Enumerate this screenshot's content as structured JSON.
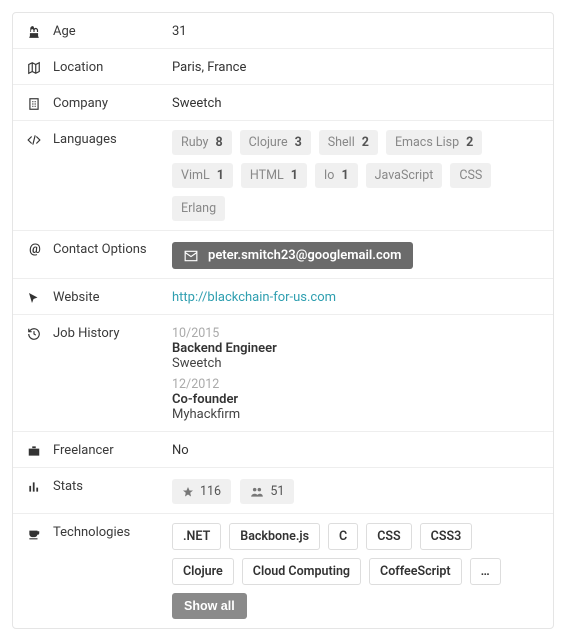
{
  "fields": {
    "age": "Age",
    "location": "Location",
    "company": "Company",
    "languages": "Languages",
    "contact": "Contact Options",
    "website": "Website",
    "job_history": "Job History",
    "freelancer": "Freelancer",
    "stats": "Stats",
    "technologies": "Technologies"
  },
  "values": {
    "age": "31",
    "location": "Paris, France",
    "company": "Sweetch",
    "freelancer": "No",
    "website": "http://blackchain-for-us.com"
  },
  "languages": [
    {
      "name": "Ruby",
      "count": "8"
    },
    {
      "name": "Clojure",
      "count": "3"
    },
    {
      "name": "Shell",
      "count": "2"
    },
    {
      "name": "Emacs Lisp",
      "count": "2"
    },
    {
      "name": "VimL",
      "count": "1"
    },
    {
      "name": "HTML",
      "count": "1"
    },
    {
      "name": "Io",
      "count": "1"
    },
    {
      "name": "JavaScript",
      "count": ""
    },
    {
      "name": "CSS",
      "count": ""
    },
    {
      "name": "Erlang",
      "count": ""
    }
  ],
  "contact": {
    "email": "peter.smitch23@googlemail.com"
  },
  "jobs": [
    {
      "date": "10/2015",
      "title": "Backend Engineer",
      "company": "Sweetch"
    },
    {
      "date": "12/2012",
      "title": "Co-founder",
      "company": "Myhackfirm"
    }
  ],
  "stats": {
    "stars": "116",
    "followers": "51"
  },
  "technologies": [
    ".NET",
    "Backbone.js",
    "C",
    "CSS",
    "CSS3",
    "Clojure",
    "Cloud Computing",
    "CoffeeScript"
  ],
  "ellipsis": "…",
  "show_all": "Show all"
}
